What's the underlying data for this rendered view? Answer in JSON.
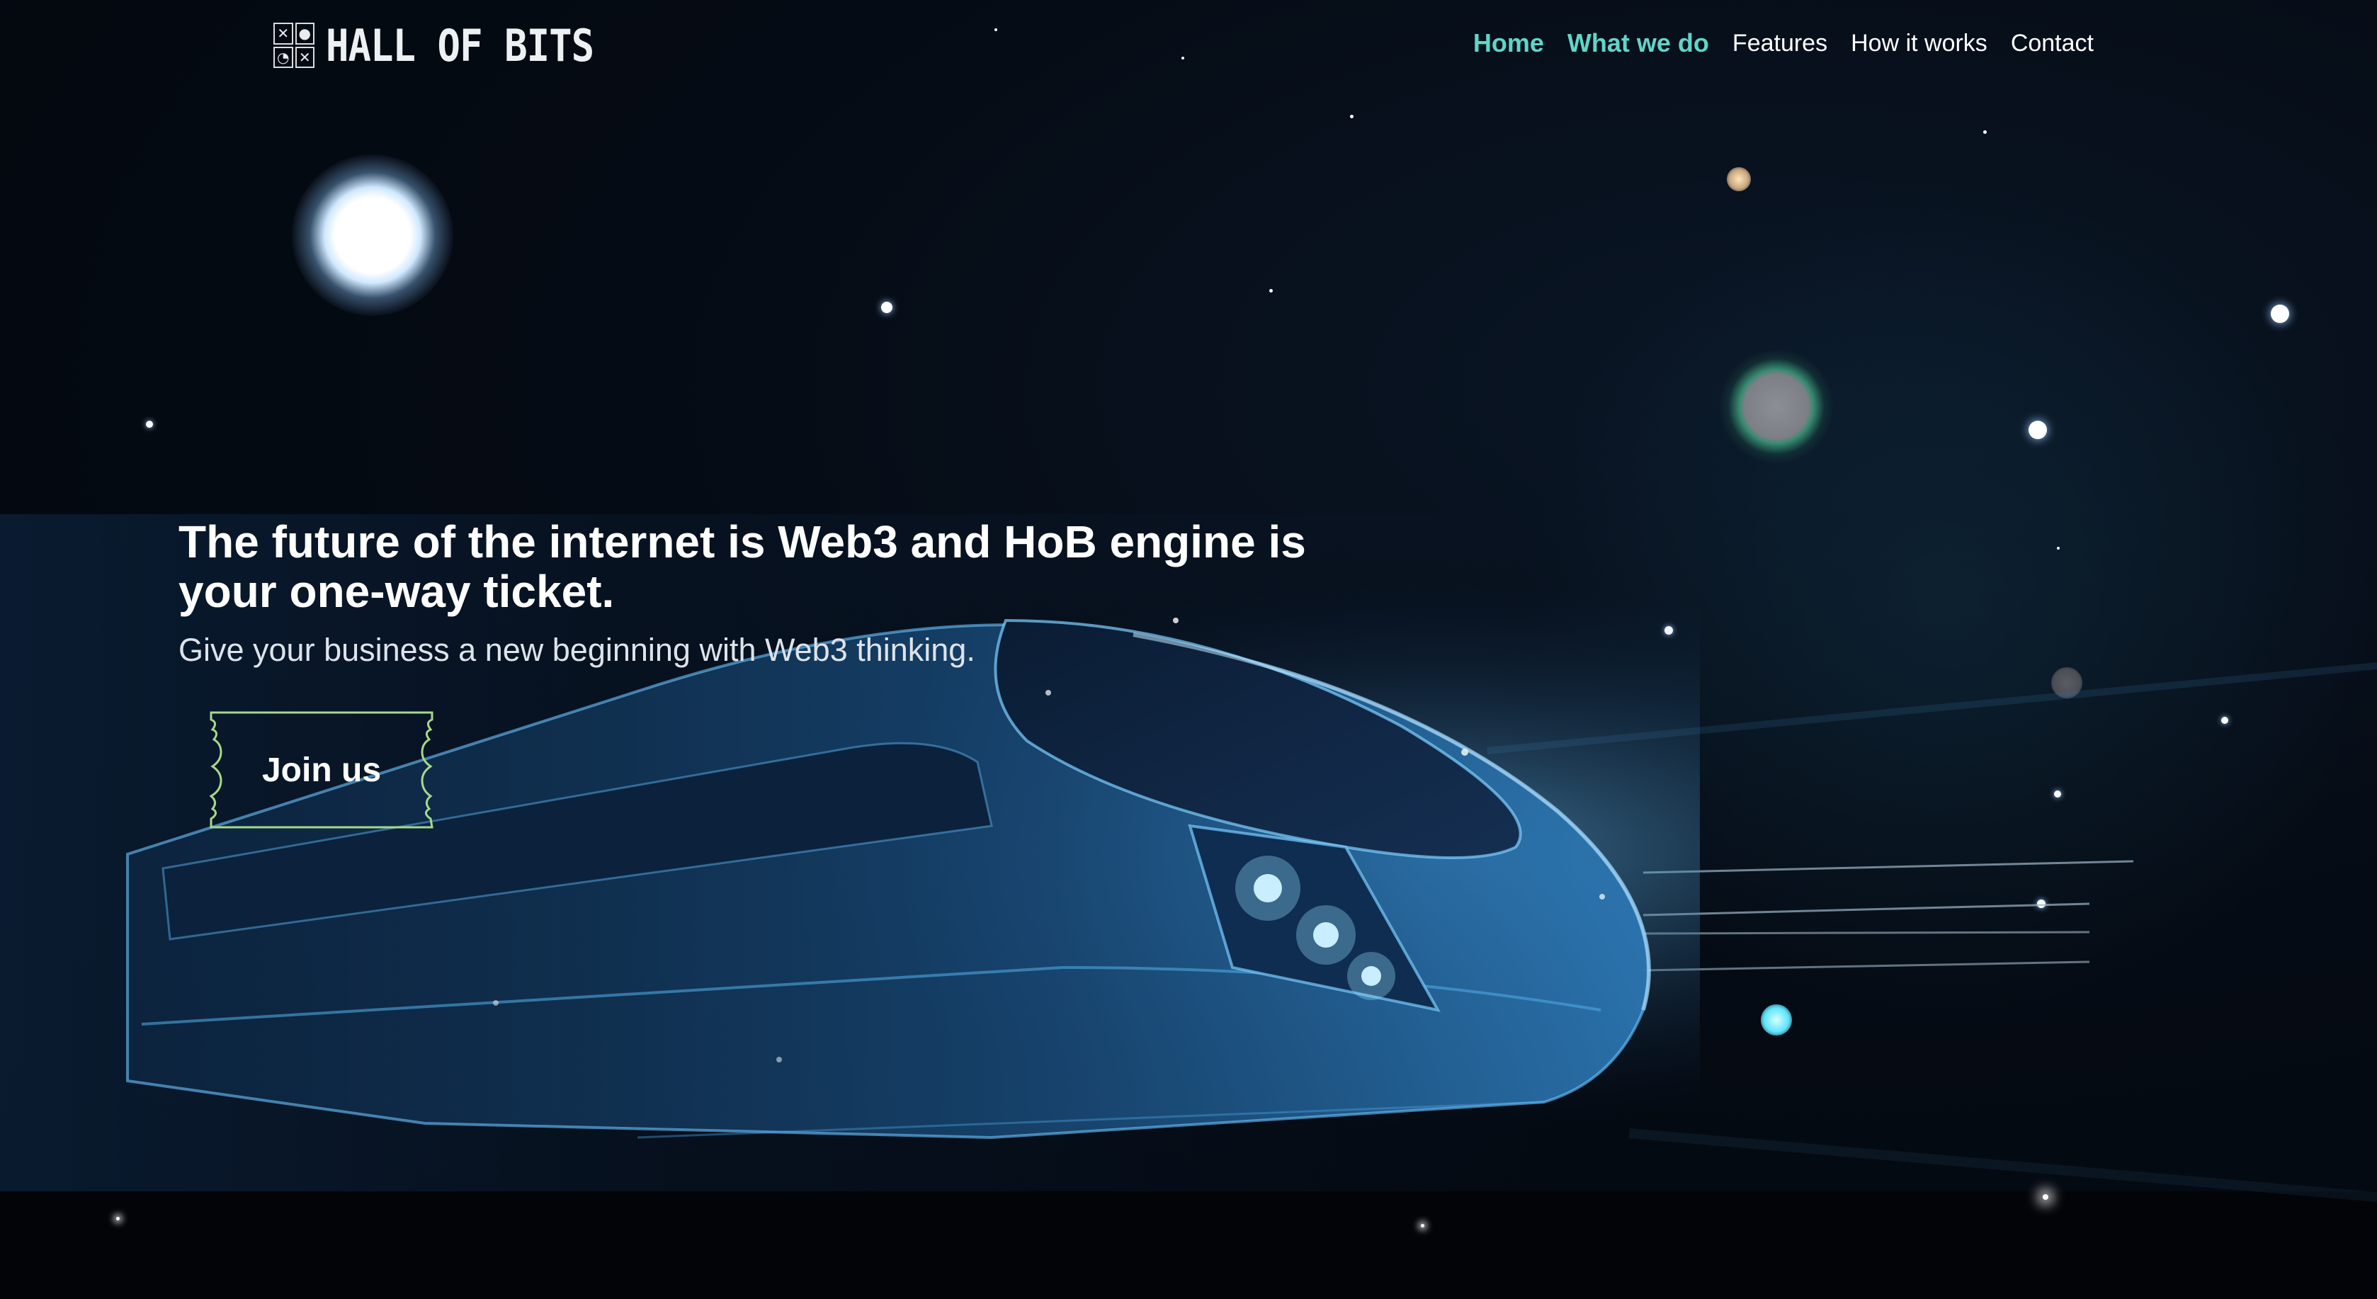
{
  "nav": {
    "logo_text": "HALL OF BITS",
    "logo_cells": [
      "✕",
      "●",
      "◔",
      "✕"
    ],
    "items": [
      {
        "label": "Home",
        "active": true
      },
      {
        "label": "What we do",
        "active": true
      },
      {
        "label": "Features",
        "active": false
      },
      {
        "label": "How it works",
        "active": false
      },
      {
        "label": "Contact",
        "active": false
      }
    ]
  },
  "hero": {
    "title_line1": "The future of the internet is Web3 and HoB engine is",
    "title_line2": "your one-way ticket.",
    "subtitle": "Give your business a new beginning with Web3 thinking.",
    "cta_label": "Join us"
  },
  "colors": {
    "accent": "#5fd6c8",
    "background": "#03070d",
    "ticket_border": "#a6d98a",
    "train_glow": "#3aa0e0"
  },
  "icons": {
    "logo": "tic-tac-toe-grid-icon",
    "cta": "ticket-shape"
  }
}
